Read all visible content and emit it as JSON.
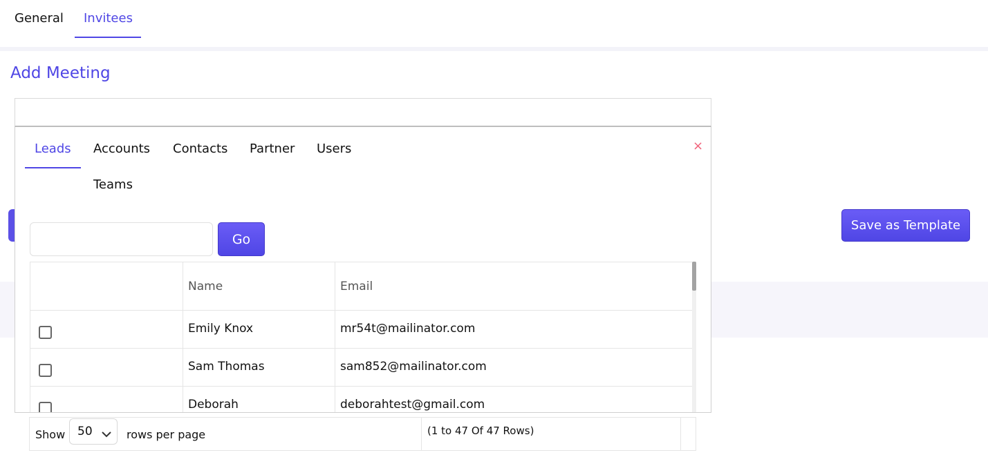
{
  "top_tabs": {
    "general": "General",
    "invitees": "Invitees"
  },
  "page": {
    "title": "Add Meeting",
    "save_template_label": "Save as Template"
  },
  "popup": {
    "tabs": [
      "Leads",
      "Accounts",
      "Contacts",
      "Partner",
      "Users",
      "Teams"
    ],
    "active_tab": "Leads",
    "close_label": "×",
    "search": {
      "value": "",
      "placeholder": ""
    },
    "go_label": "Go",
    "columns": [
      "",
      "Name",
      "Email"
    ],
    "rows": [
      {
        "name": "Emily Knox",
        "email": "mr54t@mailinator.com",
        "checked": false
      },
      {
        "name": "Sam Thomas",
        "email": "sam852@mailinator.com",
        "checked": false
      },
      {
        "name": "Deborah",
        "email": "deborahtest@gmail.com",
        "checked": false
      }
    ]
  },
  "pager": {
    "show_label": "Show",
    "rows_per_page_value": "50",
    "rows_per_page_label": "rows per page",
    "count_text": "(1 to 47 Of 47 Rows)"
  },
  "colors": {
    "accent": "#4f46e5",
    "close": "#f0627a"
  },
  "icons": {
    "close": "close-icon",
    "dropdown": "chevron-down-icon"
  }
}
